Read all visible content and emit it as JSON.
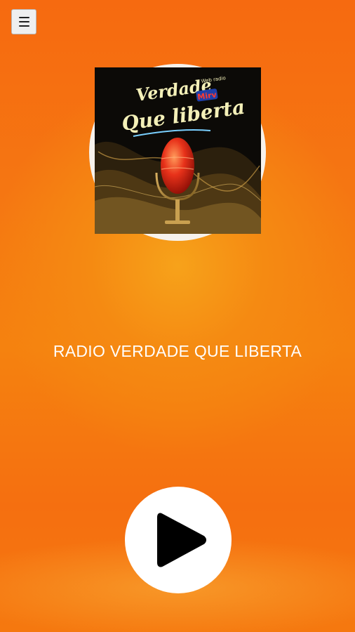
{
  "app": {
    "station_title": "RADIO VERDADE QUE LIBERTA"
  },
  "cover": {
    "title_line1": "Verdade",
    "title_line2": "Que liberta",
    "badge": "Mirv",
    "small_text": "Web radio"
  },
  "icons": {
    "menu": "hamburger-menu-icon",
    "play": "play-icon"
  },
  "colors": {
    "background_orange": "#f57a12",
    "play_button_bg": "#ffffff",
    "play_icon": "#000000",
    "title_text": "#ffffff"
  }
}
